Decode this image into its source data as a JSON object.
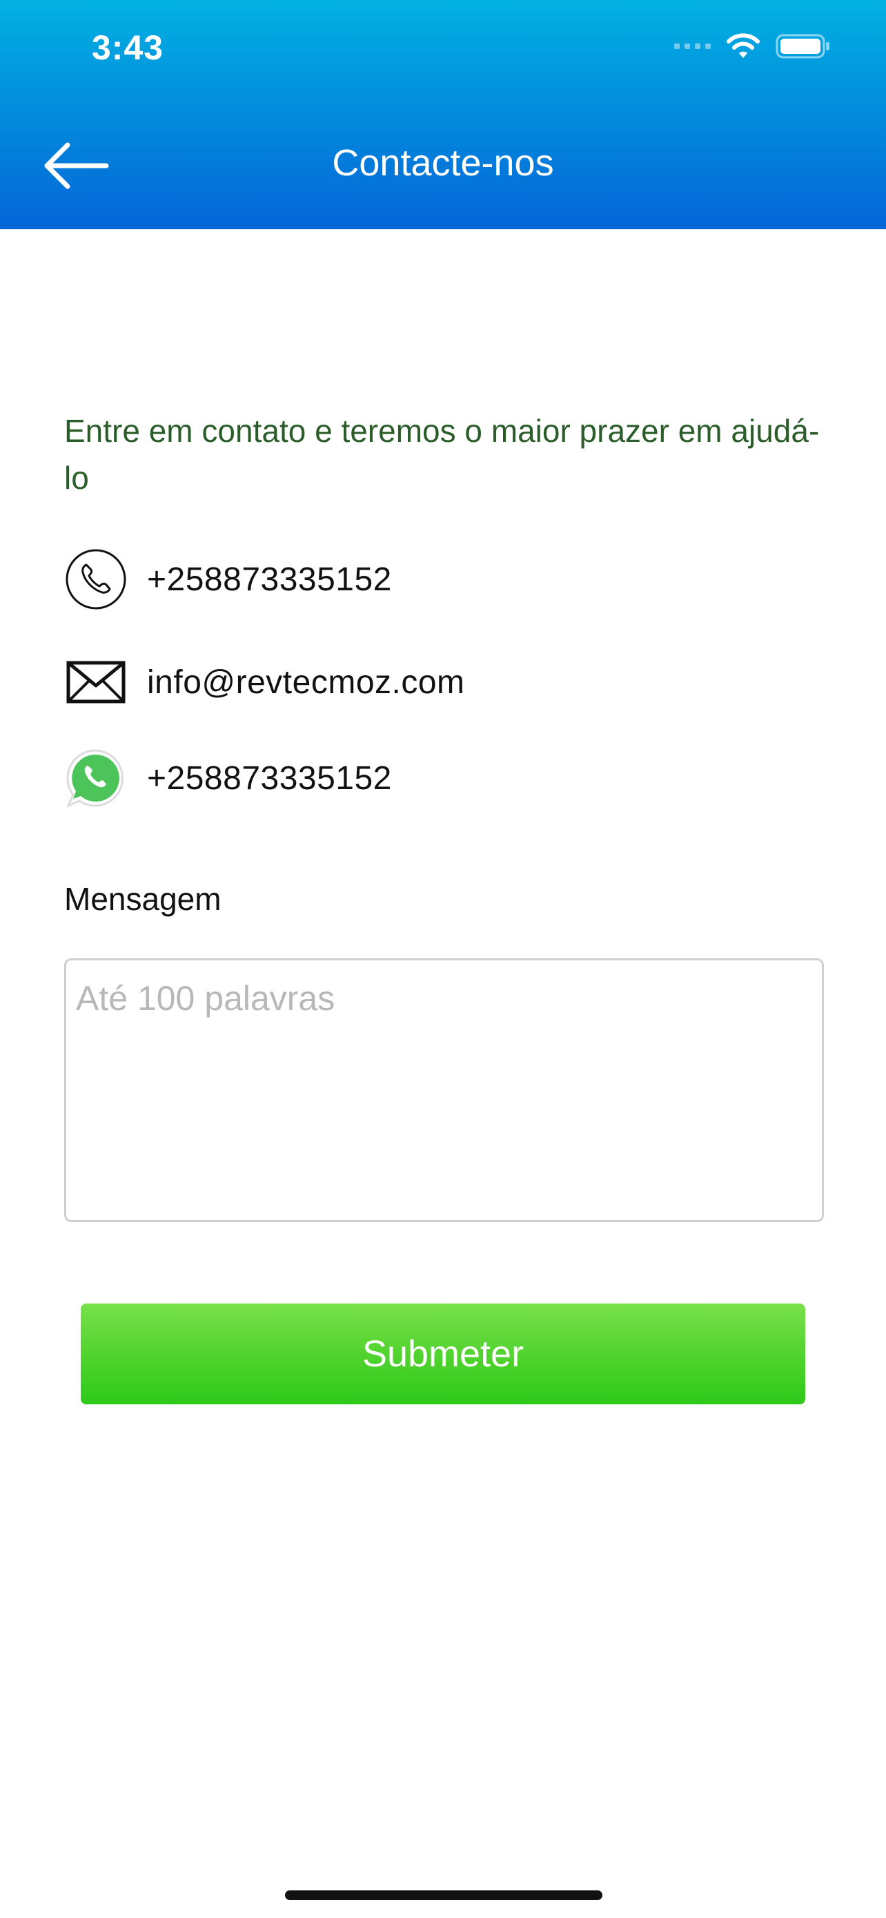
{
  "status_bar": {
    "time": "3:43",
    "icons": [
      "signal-icon",
      "wifi-icon",
      "battery-icon"
    ]
  },
  "header": {
    "back_icon": "arrow-left-icon",
    "title": "Contacte-nos",
    "gradient": [
      "#02b1e2",
      "#0466d8"
    ]
  },
  "intro": {
    "text": "Entre em contato e teremos o maior prazer em ajudá-lo",
    "color": "#2b5d2a"
  },
  "contacts": {
    "phone": {
      "icon": "phone-icon",
      "value": "+258873335152"
    },
    "email": {
      "icon": "envelope-icon",
      "value": "info@revtecmoz.com"
    },
    "whatsapp": {
      "icon": "whatsapp-icon",
      "value": "+258873335152"
    }
  },
  "message": {
    "label": "Mensagem",
    "placeholder": "Até 100 palavras",
    "value": ""
  },
  "submit": {
    "label": "Submeter",
    "gradient": [
      "#78e04a",
      "#2ec91a"
    ]
  }
}
